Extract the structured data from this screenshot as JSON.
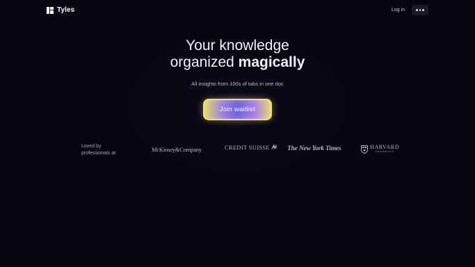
{
  "header": {
    "brand_name": "Tyles",
    "login_label": "Log in",
    "more_icon": "more-horizontal-icon"
  },
  "hero": {
    "title_line1": "Your knowledge",
    "title_line2_regular": "organized ",
    "title_line2_bold": "magically",
    "subtitle": "All insights from 100s of tabs in one doc",
    "cta_label": "Join waitlist"
  },
  "social_proof": {
    "label": "Loved by professionals at",
    "logos": {
      "mckinsey": "McKinsey&Company",
      "credit_suisse": "CREDIT SUISSE",
      "nyt": "The New York Times",
      "harvard": "HARVARD",
      "harvard_sub": "UNIVERSITY"
    }
  },
  "colors": {
    "background": "#07050f",
    "text": "#f2f0f7",
    "muted": "#bdb9c9",
    "cta_border": "#f3e35a",
    "cta_purple": "#6f63df"
  }
}
